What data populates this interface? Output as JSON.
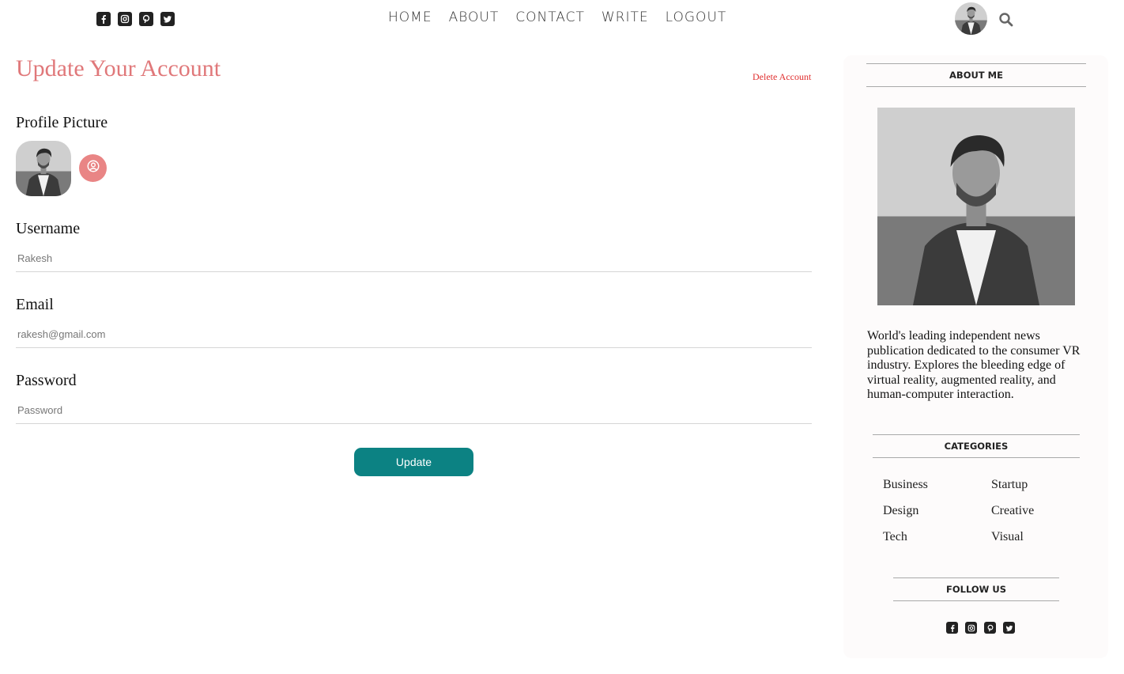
{
  "nav": {
    "items": [
      "HOME",
      "ABOUT",
      "CONTACT",
      "WRITE",
      "LOGOUT"
    ],
    "social_icons": [
      "facebook-icon",
      "instagram-icon",
      "pinterest-icon",
      "twitter-icon"
    ]
  },
  "main": {
    "title": "Update Your Account",
    "delete_label": "Delete Account",
    "profile_picture_label": "Profile Picture",
    "username_label": "Username",
    "username_value": "Rakesh",
    "email_label": "Email",
    "email_value": "rakesh@gmail.com",
    "password_label": "Password",
    "password_placeholder": "Password",
    "update_label": "Update"
  },
  "sidebar": {
    "about_heading": "ABOUT ME",
    "about_text": "World's leading independent news publication dedicated to the consumer VR industry. Explores the bleeding edge of virtual reality, augmented reality, and human-computer interaction.",
    "categories_heading": "CATEGORIES",
    "categories": [
      "Business",
      "Startup",
      "Design",
      "Creative",
      "Tech",
      "Visual"
    ],
    "follow_heading": "FOLLOW US"
  },
  "colors": {
    "title": "#e0787a",
    "delete_link": "#e03030",
    "upload_button": "#e98585",
    "update_button": "#0c8283"
  }
}
